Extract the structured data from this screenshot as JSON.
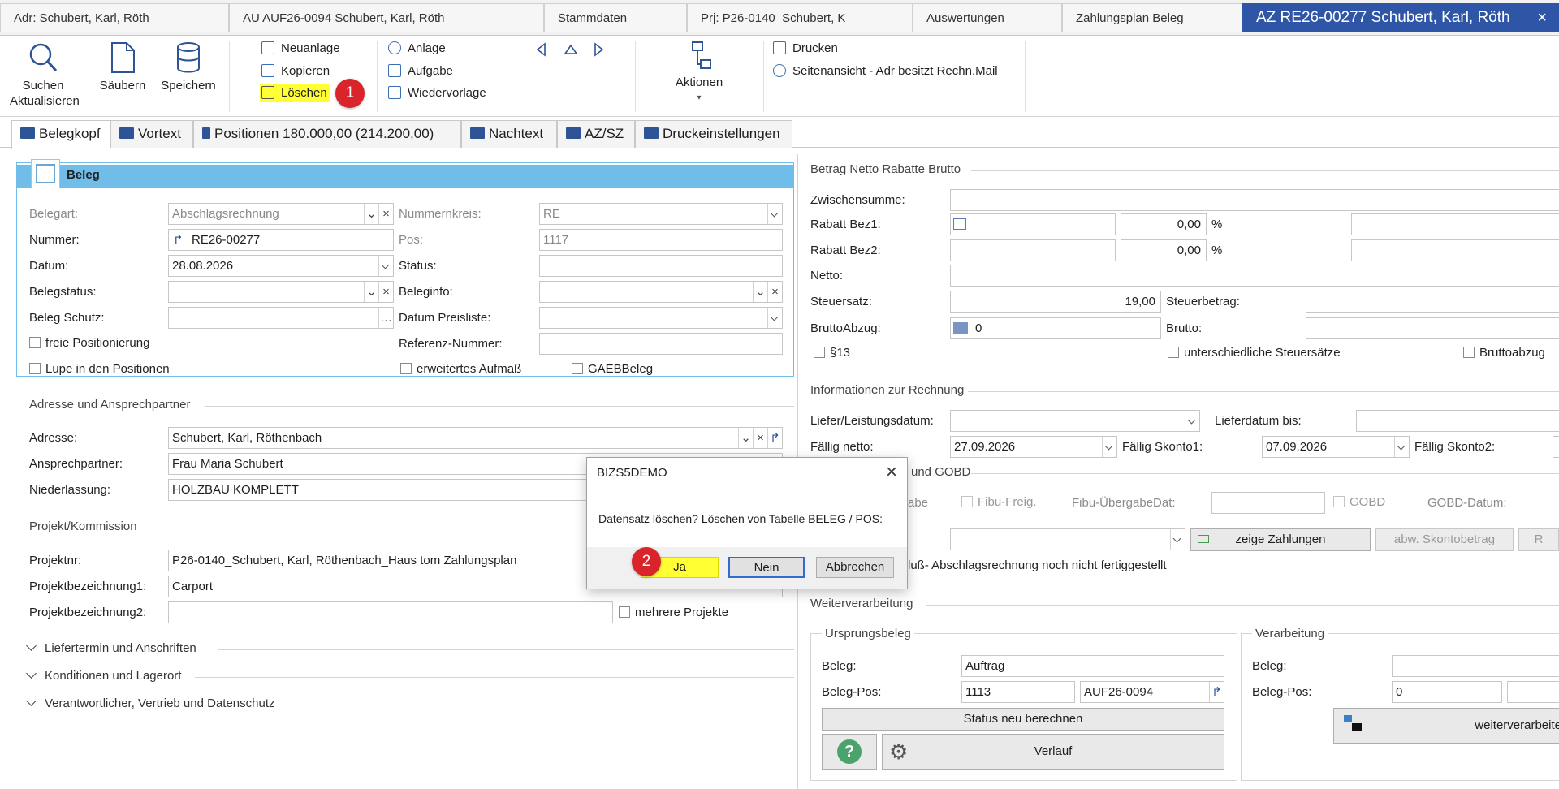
{
  "doc_tabs": [
    "Adr: Schubert, Karl, Röth",
    "AU AUF26-0094 Schubert, Karl, Röth",
    "Stammdaten",
    "Prj: P26-0140_Schubert, K",
    "Auswertungen",
    "Zahlungsplan Beleg",
    "AZ RE26-00277 Schubert, Karl, Röth"
  ],
  "doc_tab_close": "×",
  "ribbon": {
    "suchen": "Suchen",
    "aktualisieren": "Aktualisieren",
    "saeubern": "Säubern",
    "speichern": "Speichern",
    "neuanlage": "Neuanlage",
    "kopieren": "Kopieren",
    "loeschen": "Löschen",
    "anlage": "Anlage",
    "aufgabe": "Aufgabe",
    "wiedervorlage": "Wiedervorlage",
    "aktionen": "Aktionen",
    "drucken": "Drucken",
    "seitenansicht": "Seitenansicht - Adr besitzt Rechn.Mail"
  },
  "badges": {
    "one": "1",
    "two": "2"
  },
  "main_tabs": [
    "Belegkopf",
    "Vortext",
    "Positionen 180.000,00 (214.200,00)",
    "Nachtext",
    "AZ/SZ",
    "Druckeinstellungen"
  ],
  "beleg": {
    "title": "Beleg",
    "belegart_label": "Belegart:",
    "belegart": "Abschlagsrechnung",
    "nummernkreis_label": "Nummernkreis:",
    "nummernkreis": "RE",
    "nummer_label": "Nummer:",
    "nummer": "RE26-00277",
    "pos_label": "Pos:",
    "pos": "1117",
    "datum_label": "Datum:",
    "datum": "28.08.2026",
    "status_label": "Status:",
    "belegstatus_label": "Belegstatus:",
    "beleginfo_label": "Beleginfo:",
    "belegschutz_label": "Beleg Schutz:",
    "datum_preisliste_label": "Datum Preisliste:",
    "freie_pos": "freie Positionierung",
    "referenz_label": "Referenz-Nummer:",
    "lupe": "Lupe in den Positionen",
    "aufmass": "erweitertes Aufmaß",
    "gaeb": "GAEBBeleg"
  },
  "adresse": {
    "title": "Adresse und Ansprechpartner",
    "adresse_label": "Adresse:",
    "adresse": "Schubert, Karl, Röthenbach",
    "ansprech_label": "Ansprechpartner:",
    "ansprech": "Frau Maria Schubert",
    "niederlassung_label": "Niederlassung:",
    "niederlassung": "HOLZBAU KOMPLETT"
  },
  "projekt": {
    "title": "Projekt/Kommission",
    "nr_label": "Projektnr:",
    "nr": "P26-0140_Schubert, Karl, Röthenbach_Haus tom Zahlungsplan",
    "bez1_label": "Projektbezeichnung1:",
    "bez1": "Carport",
    "bez2_label": "Projektbezeichnung2:",
    "mehrere": "mehrere Projekte"
  },
  "collapsed": [
    "Liefertermin und Anschriften",
    "Konditionen und Lagerort",
    "Verantwortlicher, Vertrieb und Datenschutz"
  ],
  "betrag": {
    "title": "Betrag Netto Rabatte Brutto",
    "zwischensumme_label": "Zwischensumme:",
    "rabatt1_label": "Rabatt Bez1:",
    "rabatt1": "0,00",
    "rabatt2_label": "Rabatt Bez2:",
    "rabatt2": "0,00",
    "percent": "%",
    "netto_label": "Netto:",
    "steuersatz_label": "Steuersatz:",
    "steuersatz": "19,00",
    "steuerbetrag_label": "Steuerbetrag:",
    "bruttoabzug_label": "BruttoAbzug:",
    "bruttoabzug": "0",
    "brutto_label": "Brutto:",
    "p13": "§13",
    "unterschiedliche": "unterschiedliche Steuersätze",
    "bruttoabzug_chk": "Bruttoabzug"
  },
  "info": {
    "title": "Informationen zur Rechnung",
    "liefer_label": "Liefer/Leistungsdatum:",
    "lieferbis_label": "Lieferdatum bis:",
    "faellig_netto_label": "Fällig netto:",
    "faellig_netto": "27.09.2026",
    "skonto1_label": "Fällig Skonto1:",
    "skonto1": "07.09.2026",
    "skonto2_label": "Fällig Skonto2:",
    "gobd_title": "und GOBD",
    "gabe": "abe",
    "fibu_freig": "Fibu-Freig.",
    "fibu_uebergabe": "Fibu-ÜbergabeDat:",
    "gobd": "GOBD",
    "gobd_datum": "GOBD-Datum:",
    "zeige_zahlungen": "zeige Zahlungen",
    "abw_skonto": "abw. Skontobetrag",
    "r_btn": "R",
    "schluss_text": "luß- Abschlagsrechnung noch nicht fertiggestellt"
  },
  "weiter": {
    "title": "Weiterverarbeitung",
    "ursprung_title": "Ursprungsbeleg",
    "beleg_label": "Beleg:",
    "beleg": "Auftrag",
    "belegpos_label": "Beleg-Pos:",
    "belegpos": "1113",
    "belegnr": "AUF26-0094",
    "status_btn": "Status neu berechnen",
    "verlauf": "Verlauf",
    "help": "?",
    "verarbeitung_title": "Verarbeitung",
    "v_beleg_label": "Beleg:",
    "v_belegpos_label": "Beleg-Pos:",
    "v_belegpos": "0",
    "weiterverarbeiten": "weiterverarbeite"
  },
  "dialog": {
    "title": "BIZS5DEMO",
    "message": "Datensatz löschen?  Löschen von Tabelle BELEG / POS:",
    "ja": "Ja",
    "nein": "Nein",
    "abbrechen": "Abbrechen",
    "close": "×"
  },
  "colors": {
    "accent": "#2f56a6",
    "highlight": "#ffff33",
    "badge": "#d8242a",
    "group_header": "#6fbde8"
  }
}
